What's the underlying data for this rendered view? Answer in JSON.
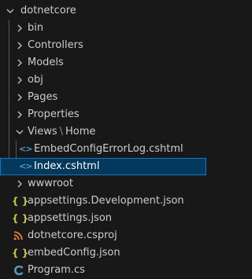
{
  "explorer": {
    "root": {
      "label": "dotnetcore"
    },
    "folders": {
      "bin": "bin",
      "controllers": "Controllers",
      "models": "Models",
      "obj": "obj",
      "pages": "Pages",
      "properties": "Properties",
      "views": "Views",
      "views_sep": "\\",
      "home": "Home",
      "wwwroot": "wwwroot"
    },
    "files": {
      "embed_error_log": "EmbedConfigErrorLog.cshtml",
      "index": "Index.cshtml",
      "appsettings_dev": "appsettings.Development.json",
      "appsettings": "appsettings.json",
      "csproj": "dotnetcore.csproj",
      "embed_config": "embedConfig.json",
      "program": "Program.cs"
    },
    "icons": {
      "razor": "<>",
      "json": "{ }"
    },
    "colors": {
      "background": "#181818",
      "selected_background": "#04395e",
      "selected_border": "#0078d4",
      "razor_icon": "#519aba",
      "json_icon": "#cbcb41",
      "rss_icon": "#e37933",
      "csharp_icon": "#519aba"
    }
  }
}
